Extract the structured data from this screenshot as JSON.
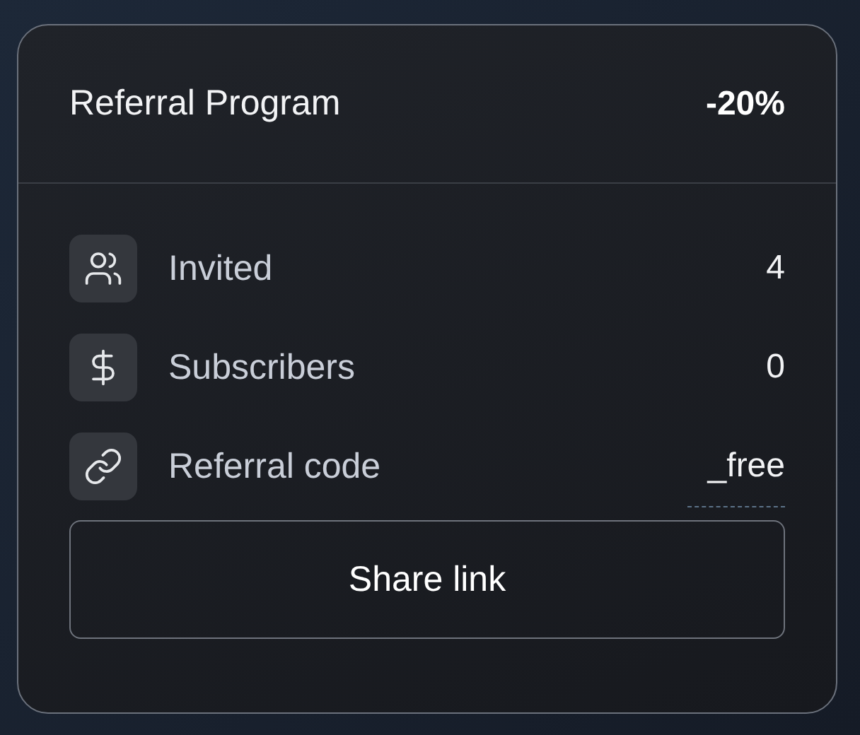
{
  "header": {
    "title": "Referral Program",
    "discount": "-20%"
  },
  "rows": [
    {
      "kind": "invited",
      "label": "Invited",
      "value": "4"
    },
    {
      "kind": "subscribers",
      "label": "Subscribers",
      "value": "0"
    },
    {
      "kind": "code",
      "label": "Referral code",
      "value": "_free"
    }
  ],
  "button": {
    "label": "Share link"
  }
}
